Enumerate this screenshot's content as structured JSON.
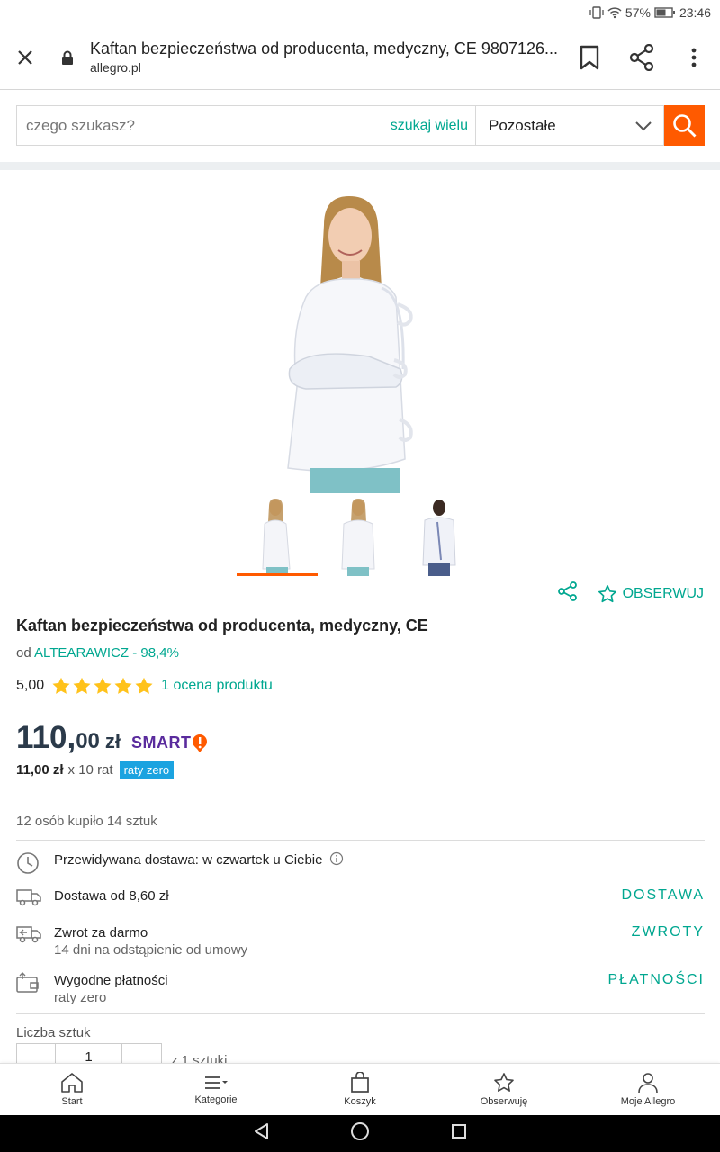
{
  "status_bar": {
    "battery": "57%",
    "time": "23:46"
  },
  "browser": {
    "page_title": "Kaftan bezpieczeństwa od producenta, medyczny, CE 9807126...",
    "domain": "allegro.pl"
  },
  "search": {
    "placeholder": "czego szukasz?",
    "multi_search_label": "szukaj wielu",
    "category": "Pozostałe"
  },
  "actions": {
    "observe_label": "OBSERWUJ"
  },
  "product": {
    "title": "Kaftan bezpieczeństwa od producenta, medyczny, CE",
    "seller_prefix": "od",
    "seller": "ALTEARAWICZ - 98,4%",
    "rating_value": "5,00",
    "rating_stars": 5,
    "rating_link": "1 ocena produktu",
    "price_int": "110,",
    "price_dec": "00",
    "price_currency": "zł",
    "smart_label": "SMART",
    "installment_amount": "11,00 zł",
    "installment_count": "x 10 rat",
    "installment_badge": "raty zero",
    "bought": "12 osób kupiło 14 sztuk"
  },
  "info_rows": [
    {
      "icon": "clock-icon",
      "text": "Przewidywana dostawa: w czwartek u Ciebie",
      "sub": "",
      "link": ""
    },
    {
      "icon": "truck-icon",
      "text": "Dostawa od 8,60 zł",
      "sub": "",
      "link": "DOSTAWA"
    },
    {
      "icon": "return-icon",
      "text": "Zwrot za darmo",
      "sub": "14 dni na odstąpienie od umowy",
      "link": "ZWROTY"
    },
    {
      "icon": "wallet-icon",
      "text": "Wygodne płatności",
      "sub": "raty zero",
      "link": "PŁATNOŚCI"
    }
  ],
  "quantity": {
    "label": "Liczba sztuk",
    "value": "1",
    "of_text": "z 1 sztuki"
  },
  "bottom_nav": {
    "start": "Start",
    "categories": "Kategorie",
    "cart": "Koszyk",
    "watch": "Obserwuję",
    "my_allegro": "Moje Allegro"
  },
  "colors": {
    "accent": "#00a790",
    "orange": "#ff5a00",
    "smart_purple": "#5a2b9d",
    "badge_blue": "#1ba3e0"
  }
}
